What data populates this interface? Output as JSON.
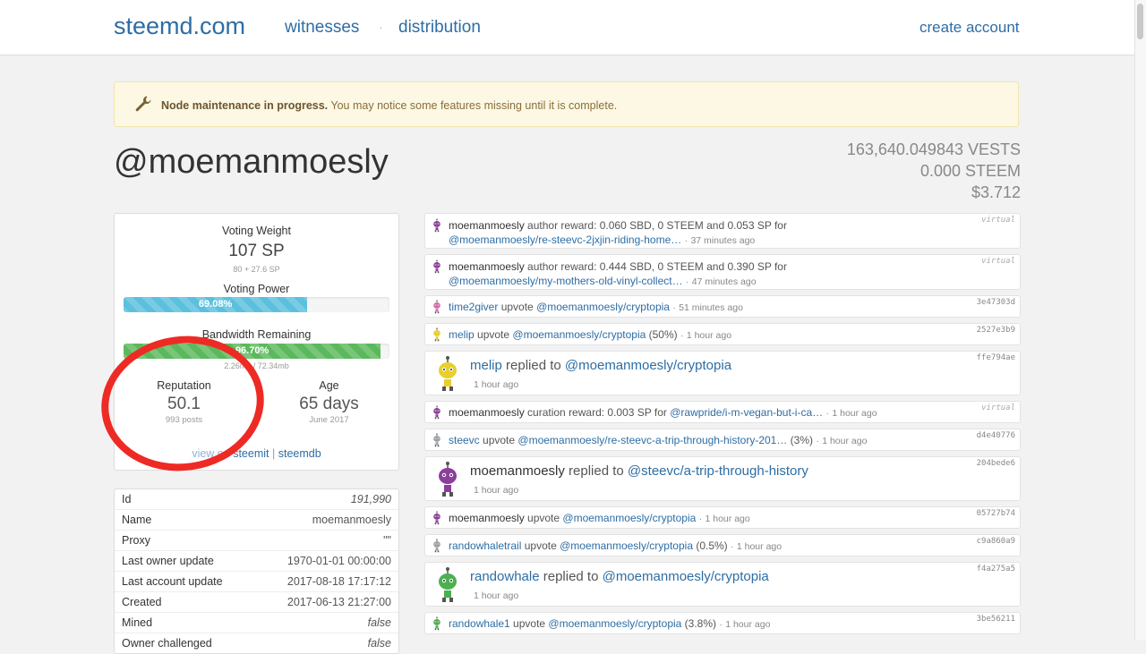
{
  "nav": {
    "brand": "steemd.com",
    "witnesses": "witnesses",
    "dot": "·",
    "distribution": "distribution",
    "create_account": "create account"
  },
  "alert": {
    "bold": "Node maintenance in progress.",
    "rest": " You may notice some features missing until it is complete.",
    "icon": "wrench-icon"
  },
  "account": {
    "name": "@moemanmoesly",
    "vests": "163,640.049843 VESTS",
    "steem": "0.000 STEEM",
    "usd": "$3.712"
  },
  "stats": {
    "voting_weight_label": "Voting Weight",
    "voting_weight": "107 SP",
    "voting_weight_sub": "80 + 27.6 SP",
    "voting_power_label": "Voting Power",
    "voting_power": "69.08%",
    "voting_power_fraction": 0.6908,
    "bandwidth_label": "Bandwidth Remaining",
    "bandwidth": "96.70%",
    "bandwidth_fraction": 0.967,
    "bandwidth_sub": "2.26mb / 72.34mb",
    "reputation_label": "Reputation",
    "reputation": "50.1",
    "posts": "993 posts",
    "age_label": "Age",
    "age": "65 days",
    "age_sub": "June 2017",
    "links": {
      "view_on": "view on",
      "steemit": "steemit",
      "sep": "|",
      "steemdb": "steemdb"
    }
  },
  "info": [
    {
      "key": "Id",
      "value": "191,990",
      "italic": true
    },
    {
      "key": "Name",
      "value": "moemanmoesly",
      "italic": false
    },
    {
      "key": "Proxy",
      "value": "\"\"",
      "italic": false
    },
    {
      "key": "Last owner update",
      "value": "1970-01-01 00:00:00",
      "italic": false
    },
    {
      "key": "Last account update",
      "value": "2017-08-18 17:17:12",
      "italic": false
    },
    {
      "key": "Created",
      "value": "2017-06-13 21:27:00",
      "italic": false
    },
    {
      "key": "Mined",
      "value": "false",
      "italic": true
    },
    {
      "key": "Owner challenged",
      "value": "false",
      "italic": true
    }
  ],
  "colors": {
    "accent": "#2e6da4",
    "voting_bar": "#5bc0de",
    "bandwidth_bar": "#5cb85c",
    "annotation": "#ee2a24"
  },
  "feed": [
    {
      "type": "small",
      "avatar": "purple",
      "user": "moemanmoesly",
      "line1": " author reward: 0.060 SBD, 0 STEEM and 0.053 SP for",
      "link": "@moemanmoesly/re-steevc-2jxjin-riding-home…",
      "time": "37 minutes ago",
      "hash": "virtual",
      "virtual": true,
      "two_line": true
    },
    {
      "type": "small",
      "avatar": "purple",
      "user": "moemanmoesly",
      "line1": " author reward: 0.444 SBD, 0 STEEM and 0.390 SP for",
      "link": "@moemanmoesly/my-mothers-old-vinyl-collect…",
      "time": "47 minutes ago",
      "hash": "virtual",
      "virtual": true,
      "two_line": true
    },
    {
      "type": "small",
      "avatar": "pink",
      "user": "time2giver",
      "action": " upvote ",
      "link": "@moemanmoesly/cryptopia",
      "extra": "",
      "time": "51 minutes ago",
      "hash": "3e47303d",
      "virtual": false
    },
    {
      "type": "small",
      "avatar": "yellow",
      "user": "melip",
      "action": " upvote ",
      "link": "@moemanmoesly/cryptopia",
      "extra": " (50%)",
      "time": "1 hour ago",
      "hash": "2527e3b9",
      "virtual": false
    },
    {
      "type": "big",
      "avatar": "yellow",
      "user": "melip",
      "action": " replied to ",
      "link": "@moemanmoesly/cryptopia",
      "time": "1 hour ago",
      "hash": "ffe794ae"
    },
    {
      "type": "small",
      "avatar": "purple",
      "user": "moemanmoesly",
      "action": " curation reward: 0.003 SP for ",
      "link": "@rawpride/i-m-vegan-but-i-ca…",
      "extra": "",
      "time": "1 hour ago",
      "hash": "virtual",
      "virtual": true
    },
    {
      "type": "small",
      "avatar": "grey",
      "user": "steevc",
      "action": " upvote ",
      "link": "@moemanmoesly/re-steevc-a-trip-through-history-201…",
      "extra": " (3%)",
      "time": "1 hour ago",
      "hash": "d4e40776",
      "virtual": false
    },
    {
      "type": "big",
      "avatar": "purple",
      "user": "moemanmoesly",
      "action": " replied to ",
      "link": "@steevc/a-trip-through-history",
      "time": "1 hour ago",
      "hash": "204bede6"
    },
    {
      "type": "small",
      "avatar": "purple",
      "user": "moemanmoesly",
      "action": " upvote ",
      "link": "@moemanmoesly/cryptopia",
      "extra": "",
      "time": "1 hour ago",
      "hash": "05727b74",
      "virtual": false
    },
    {
      "type": "small",
      "avatar": "grey",
      "user": "randowhaletrail",
      "action": " upvote ",
      "link": "@moemanmoesly/cryptopia",
      "extra": " (0.5%)",
      "time": "1 hour ago",
      "hash": "c9a860a9",
      "virtual": false
    },
    {
      "type": "big",
      "avatar": "green",
      "user": "randowhale",
      "action": " replied to ",
      "link": "@moemanmoesly/cryptopia",
      "time": "1 hour ago",
      "hash": "f4a275a5"
    },
    {
      "type": "small",
      "avatar": "green",
      "user": "randowhale1",
      "action": " upvote ",
      "link": "@moemanmoesly/cryptopia",
      "extra": " (3.8%)",
      "time": "1 hour ago",
      "hash": "3be56211",
      "virtual": false
    }
  ]
}
